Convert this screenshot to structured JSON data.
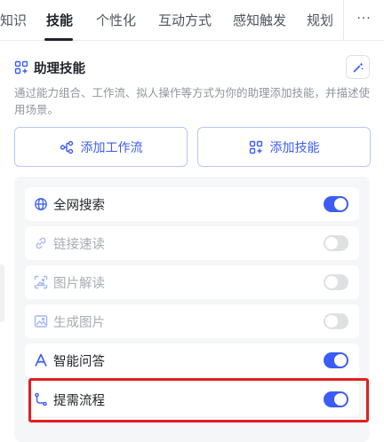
{
  "tabs": [
    {
      "label": "知识"
    },
    {
      "label": "技能"
    },
    {
      "label": "个性化"
    },
    {
      "label": "互动方式"
    },
    {
      "label": "感知触发"
    },
    {
      "label": "规划"
    }
  ],
  "tabs_more": "···",
  "active_tab": "技能",
  "section": {
    "title": "助理技能",
    "icon": "grid-plus-icon",
    "magic_icon": "magic-wand-icon",
    "description": "通过能力组合、工作流、拟人操作等方式为你的助理添加技能，并描述使用场景。"
  },
  "actions": {
    "add_workflow": {
      "label": "添加工作流",
      "icon": "workflow-icon"
    },
    "add_skill": {
      "label": "添加技能",
      "icon": "grid-plus-icon"
    }
  },
  "skills": [
    {
      "label": "全网搜索",
      "icon": "globe-icon",
      "enabled": true
    },
    {
      "label": "链接速读",
      "icon": "link-icon",
      "enabled": false
    },
    {
      "label": "图片解读",
      "icon": "image-scan-icon",
      "enabled": false
    },
    {
      "label": "生成图片",
      "icon": "image-icon",
      "enabled": false
    },
    {
      "label": "智能问答",
      "icon": "ai-letter-a-icon",
      "enabled": true
    },
    {
      "label": "提需流程",
      "icon": "flow-path-icon",
      "enabled": true
    }
  ],
  "colors": {
    "accent": "#3b5cf5",
    "highlight": "#e02020",
    "toggle_off": "#dee0e3"
  }
}
